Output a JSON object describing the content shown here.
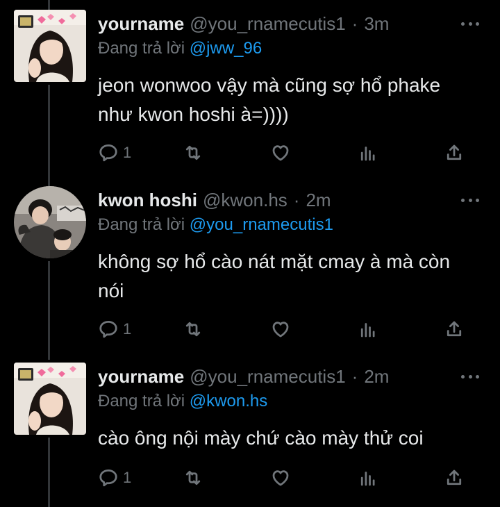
{
  "colors": {
    "background": "#000000",
    "text_primary": "#e7e9ea",
    "text_secondary": "#71767b",
    "mention": "#1d9bf0",
    "thread_line": "#333639"
  },
  "icons": {
    "reply": "reply-icon",
    "retweet": "retweet-icon",
    "like": "heart-icon",
    "views": "views-icon",
    "share": "share-icon",
    "more": "more-icon"
  },
  "tweets": [
    {
      "display_name": "yourname",
      "handle": "@you_rnamecutis1",
      "separator": "·",
      "time": "3m",
      "reply_prefix": "Đang trả lời",
      "reply_mention": "@jww_96",
      "text": "jeon wonwoo vậy mà cũng sợ hổ phake như kwon hoshi à=))))",
      "reply_count": "1"
    },
    {
      "display_name": "kwon hoshi",
      "handle": "@kwon.hs",
      "separator": "·",
      "time": "2m",
      "reply_prefix": "Đang trả lời",
      "reply_mention": "@you_rnamecutis1",
      "text": "không sợ hổ cào nát mặt cmay à mà còn nói",
      "reply_count": "1"
    },
    {
      "display_name": "yourname",
      "handle": "@you_rnamecutis1",
      "separator": "·",
      "time": "2m",
      "reply_prefix": "Đang trả lời",
      "reply_mention": "@kwon.hs",
      "text": "cào ông nội mày chứ cào mày thử coi",
      "reply_count": "1"
    }
  ]
}
